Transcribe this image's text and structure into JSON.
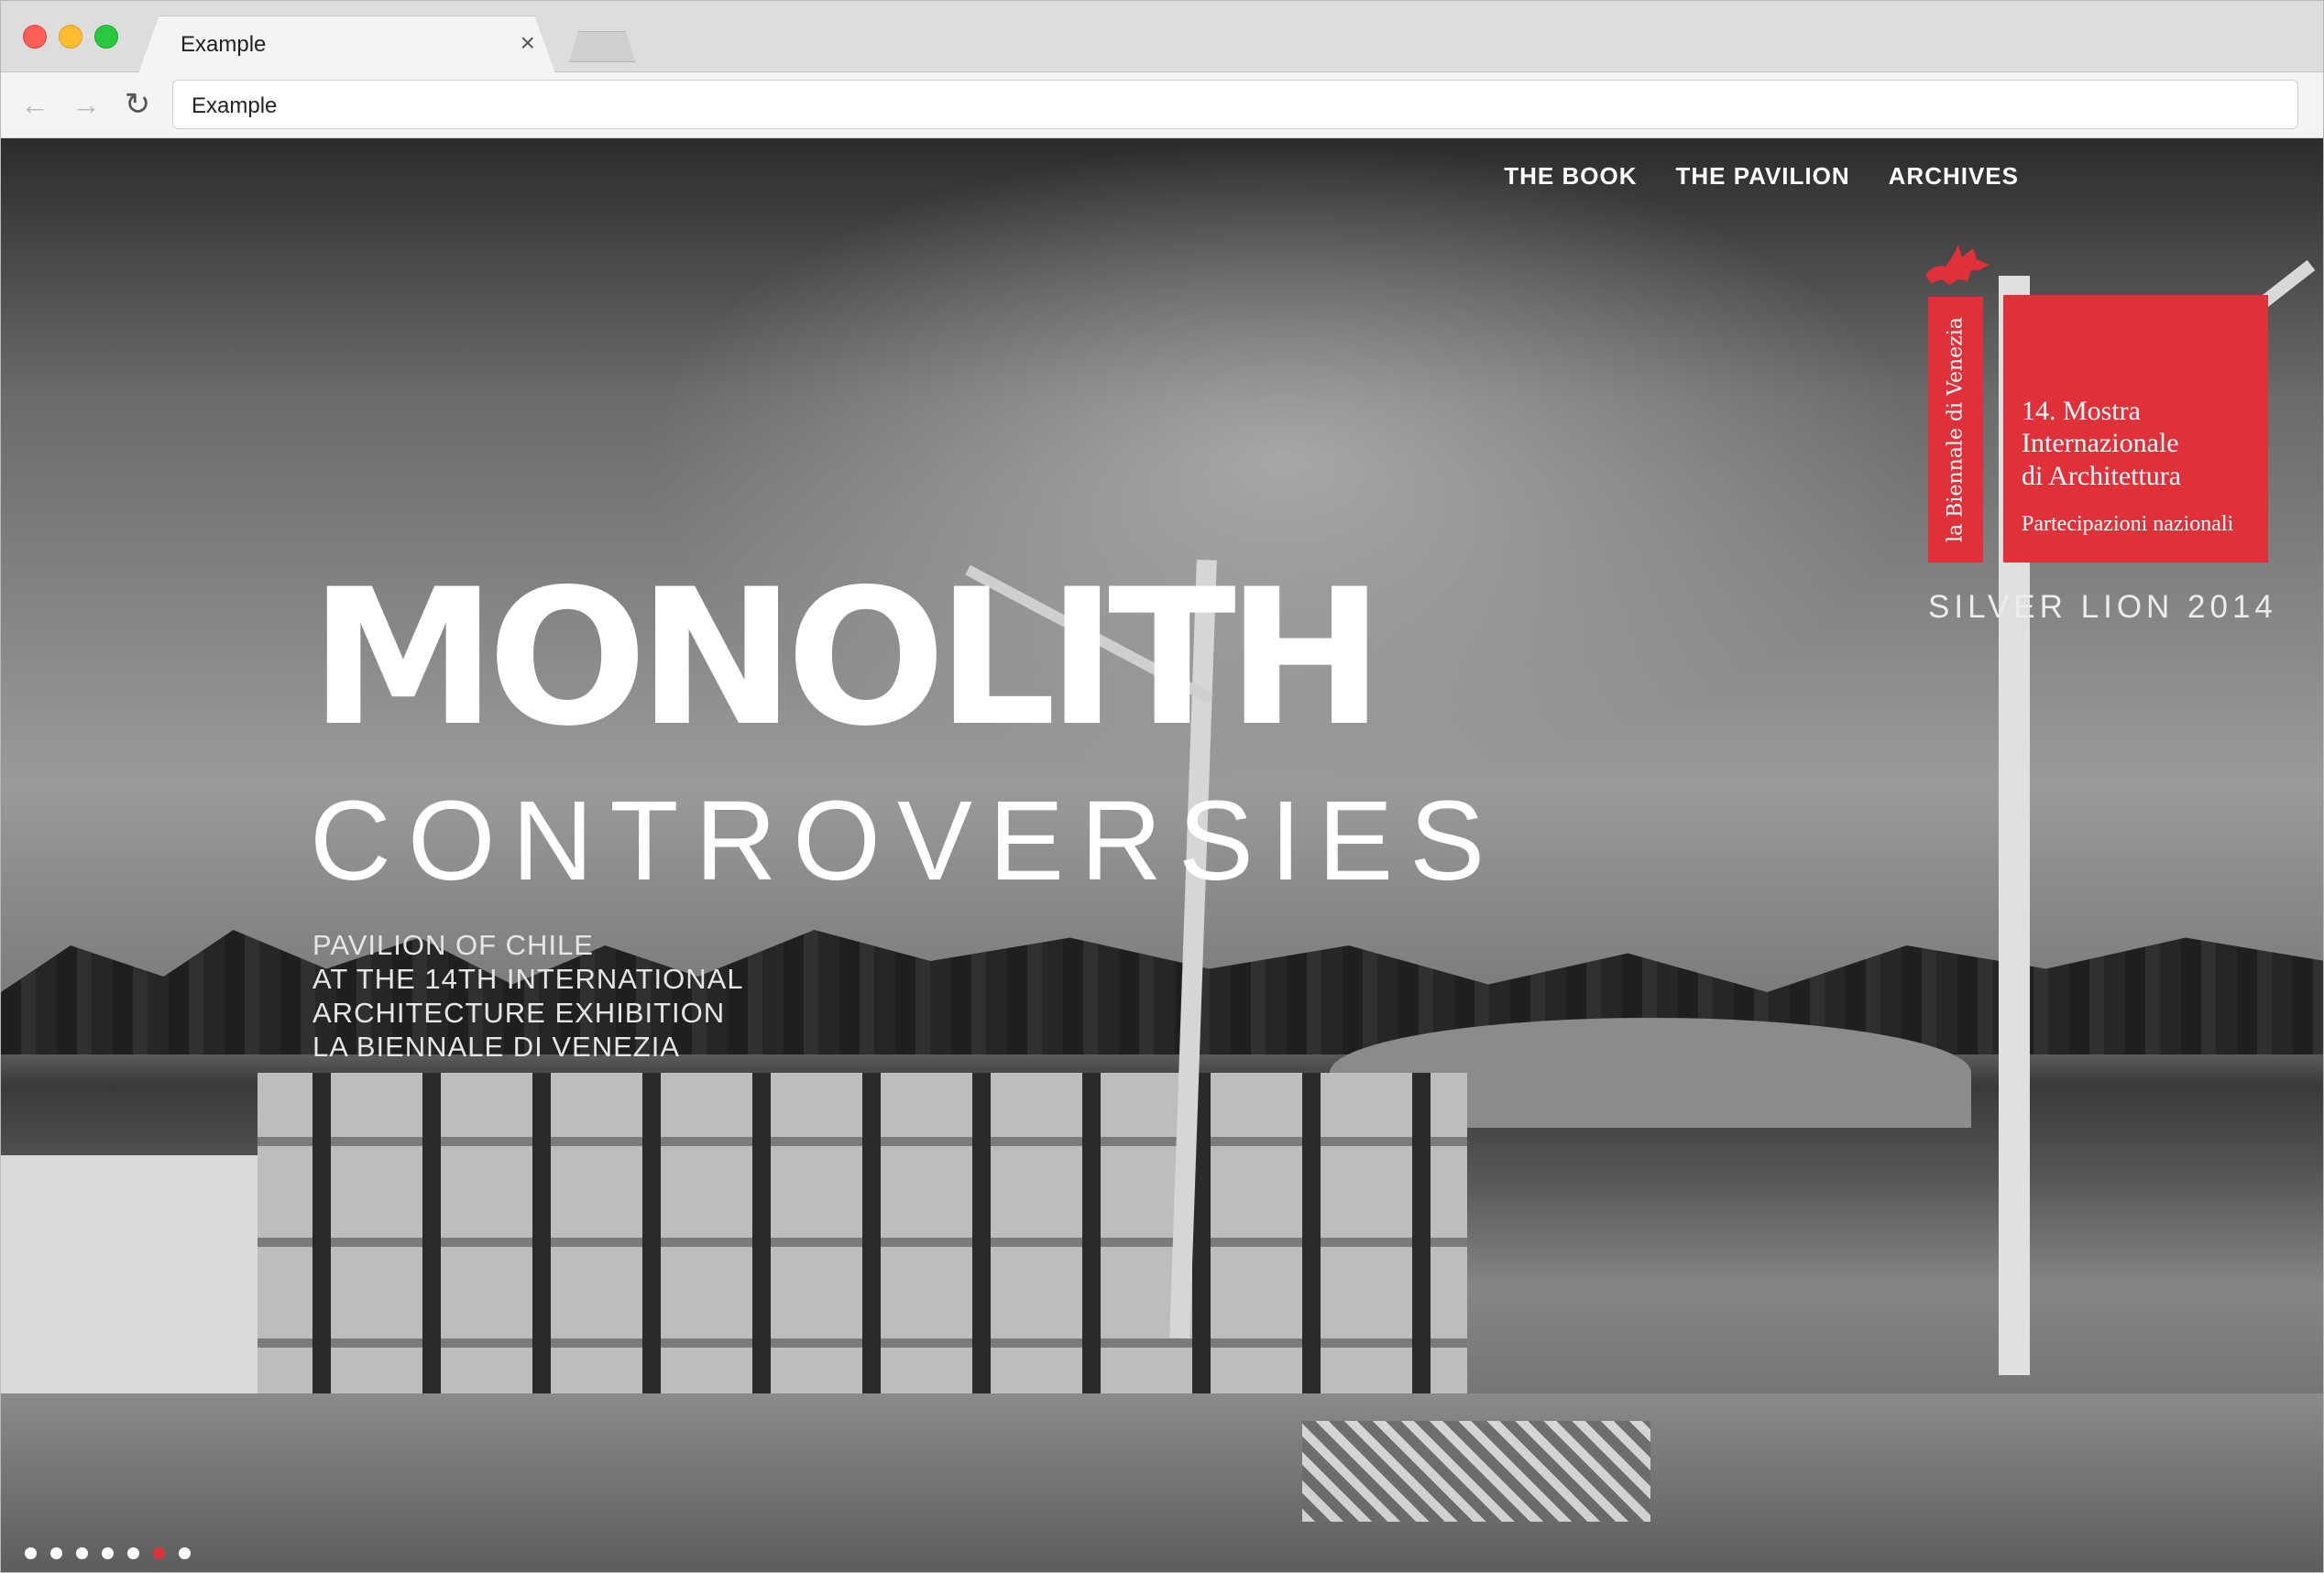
{
  "browser": {
    "tab_title": "Example",
    "tab_close_icon": "close-icon",
    "url": "Example"
  },
  "nav": {
    "items": [
      {
        "label": "THE BOOK"
      },
      {
        "label": "THE PAVILION"
      },
      {
        "label": "ARCHIVES"
      }
    ]
  },
  "logo": {
    "strip_text": "la Biennale di Venezia",
    "lines": [
      "14. Mostra",
      "Internazionale",
      "di Architettura",
      "Partecipazioni nazionali"
    ],
    "award": "SILVER LION 2014",
    "brand_color": "#e0313a"
  },
  "hero": {
    "title": "MONOLITH",
    "subtitle": "CONTROVERSIES",
    "tagline": [
      "PAVILION OF CHILE",
      "AT THE 14TH INTERNATIONAL",
      "ARCHITECTURE EXHIBITION",
      "LA BIENNALE DI VENEZIA"
    ]
  },
  "slider": {
    "total": 7,
    "active_index": 5
  }
}
